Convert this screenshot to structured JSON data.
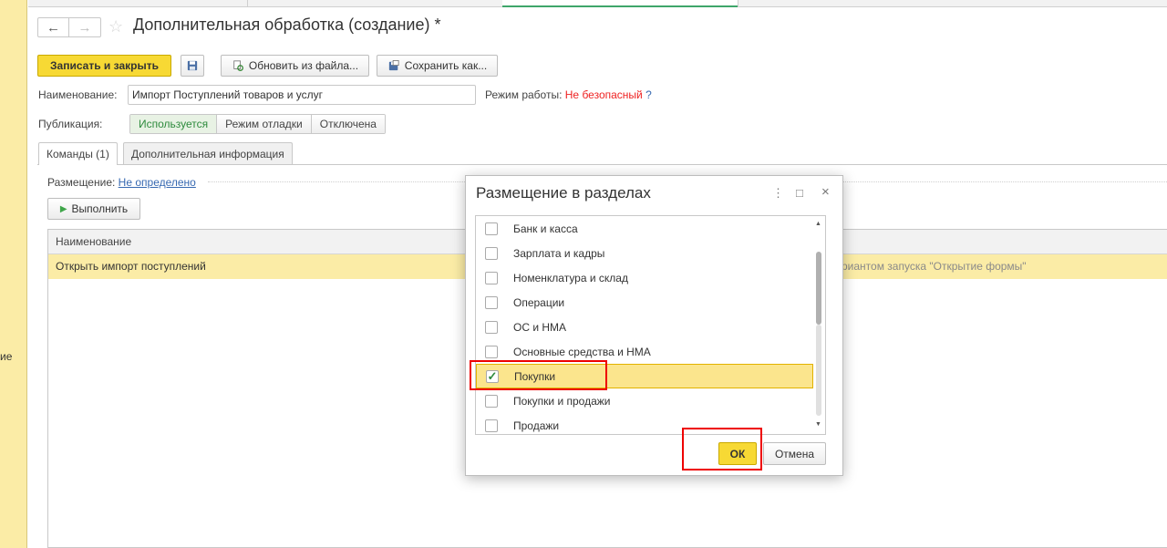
{
  "left_panel": {
    "fragment": "ие"
  },
  "header": {
    "title": "Дополнительная обработка (создание) *"
  },
  "toolbar": {
    "save_close": "Записать и закрыть",
    "update_from_file": "Обновить из файла...",
    "save_as": "Сохранить как..."
  },
  "form": {
    "name_label": "Наименование:",
    "name_value": "Импорт Поступлений товаров и услуг",
    "mode_label": "Режим работы:",
    "mode_value": "Не безопасный",
    "mode_help": "?",
    "publication_label": "Публикация:",
    "publication_options": [
      "Используется",
      "Режим отладки",
      "Отключена"
    ],
    "publication_selected": "Используется"
  },
  "tabs": [
    {
      "label": "Команды (1)"
    },
    {
      "label": "Дополнительная информация"
    }
  ],
  "commands": {
    "placement_label": "Размещение:",
    "placement_value": "Не определено",
    "run_button": "Выполнить",
    "table_header": "Наименование",
    "rows": [
      {
        "name": "Открыть импорт поступлений",
        "tail": "риантом запуска \"Открытие формы\""
      }
    ]
  },
  "dialog": {
    "title": "Размещение в разделах",
    "items": [
      {
        "label": "Банк и касса",
        "checked": false
      },
      {
        "label": "Зарплата и кадры",
        "checked": false
      },
      {
        "label": "Номенклатура и склад",
        "checked": false
      },
      {
        "label": "Операции",
        "checked": false
      },
      {
        "label": "ОС и НМА",
        "checked": false
      },
      {
        "label": "Основные средства и НМА",
        "checked": false
      },
      {
        "label": "Покупки",
        "checked": true
      },
      {
        "label": "Покупки и продажи",
        "checked": false
      },
      {
        "label": "Продажи",
        "checked": false
      }
    ],
    "ok": "ОК",
    "cancel": "Отмена"
  },
  "colors": {
    "accent_yellow": "#f7d934",
    "highlight_yellow": "#fbeca6",
    "selected_row": "#fbe58d",
    "link_blue": "#3769b1",
    "warning_red": "#ee2222",
    "active_green": "#2e8b3d",
    "annotation_red": "#e00000"
  }
}
